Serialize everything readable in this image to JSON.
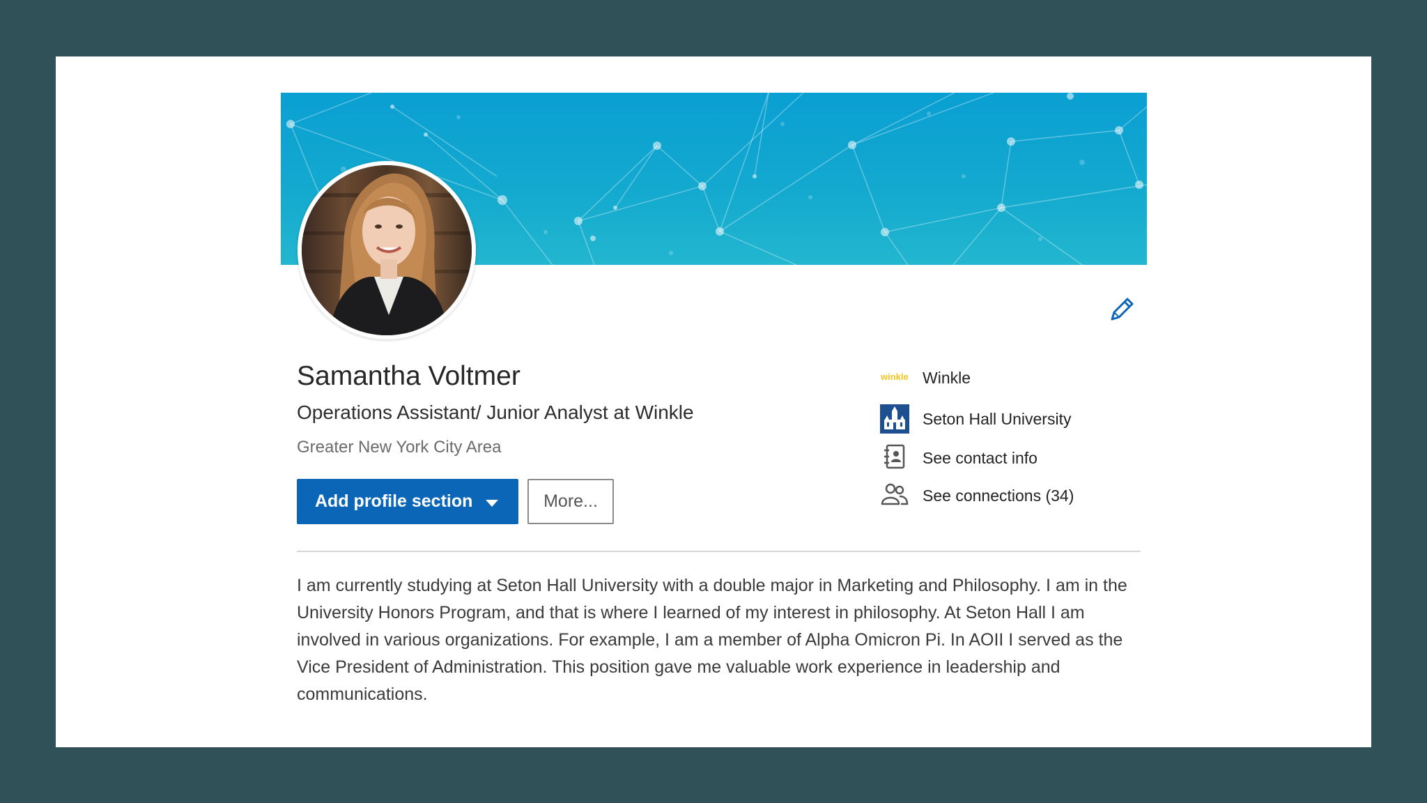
{
  "profile": {
    "name": "Samantha Voltmer",
    "headline": "Operations Assistant/ Junior Analyst at Winkle",
    "location": "Greater New York City Area"
  },
  "actions": {
    "add_section_label": "Add profile section",
    "more_label": "More..."
  },
  "sidebar": {
    "items": [
      {
        "label": "Winkle",
        "icon": "winkle-logo-icon"
      },
      {
        "label": "Seton Hall University",
        "icon": "university-logo-icon"
      },
      {
        "label": "See contact info",
        "icon": "contact-card-icon"
      },
      {
        "label": "See connections (34)",
        "icon": "people-icon"
      }
    ],
    "winkle_logo_text": "winkle"
  },
  "summary": {
    "text": "I am currently studying at Seton Hall University with a double major in Marketing and Philosophy. I am in the University Honors Program, and that is where I learned of my interest in philosophy. At Seton Hall I am involved in various organizations. For example, I am a member of Alpha Omicron Pi. In AOII I served as the Vice President of Administration. This position gave me valuable work experience in leadership and communications."
  },
  "colors": {
    "page_background": "#2f5157",
    "banner": "#13a9cf",
    "primary_button": "#0b66b8",
    "edit_icon": "#0b66b8"
  }
}
